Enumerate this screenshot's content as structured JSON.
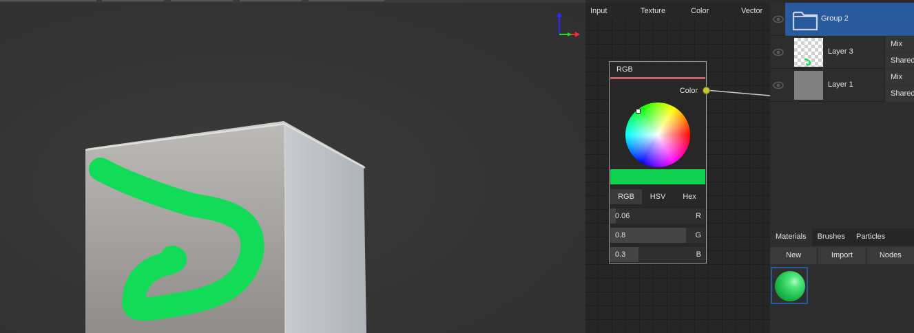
{
  "node_editor": {
    "menu": [
      "Input",
      "Texture",
      "Color",
      "Vector"
    ],
    "rgb_node": {
      "title": "RGB",
      "output_label": "Color",
      "swatch_color": "#11d250",
      "title_bar_color": "#c5646b",
      "modes": [
        "RGB",
        "HSV",
        "Hex"
      ],
      "active_mode": "RGB",
      "channels": [
        {
          "value": "0.06",
          "channel": "R",
          "level": 0.06
        },
        {
          "value": "0.8",
          "channel": "G",
          "level": 0.8
        },
        {
          "value": "0.3",
          "channel": "B",
          "level": 0.3
        }
      ]
    }
  },
  "layers": {
    "items": [
      {
        "name": "Group 2",
        "type": "group",
        "selected": true
      },
      {
        "name": "Layer 3",
        "type": "layer",
        "blend": "Mix",
        "mode": "Shared"
      },
      {
        "name": "Layer 1",
        "type": "layer",
        "blend": "Mix",
        "mode": "Shared"
      }
    ]
  },
  "materials": {
    "tabs": [
      "Materials",
      "Brushes",
      "Particles"
    ],
    "active_tab": "Materials",
    "buttons": [
      "New",
      "Import",
      "Nodes"
    ]
  },
  "colors": {
    "selection": "#2a5a9e",
    "paint_stroke": "#12db57",
    "socket": "#c7c734"
  }
}
